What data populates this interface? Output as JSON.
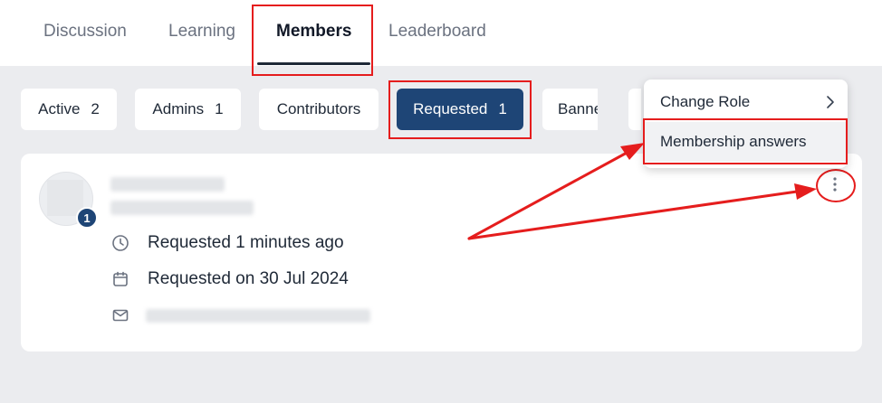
{
  "tabs": [
    {
      "label": "Discussion",
      "active": false
    },
    {
      "label": "Learning",
      "active": false
    },
    {
      "label": "Members",
      "active": true
    },
    {
      "label": "Leaderboard",
      "active": false
    }
  ],
  "filters": [
    {
      "label": "Active",
      "count": "2",
      "active": false
    },
    {
      "label": "Admins",
      "count": "1",
      "active": false
    },
    {
      "label": "Contributors",
      "count": "",
      "active": false
    },
    {
      "label": "Requested",
      "count": "1",
      "active": true
    },
    {
      "label": "Banne",
      "count": "",
      "active": false
    }
  ],
  "member": {
    "badge_count": "1",
    "requested_ago": "Requested 1 minutes ago",
    "requested_on": "Requested on 30 Jul 2024"
  },
  "menu": {
    "items": [
      {
        "label": "Change Role",
        "has_submenu": true
      },
      {
        "label": "Membership answers",
        "has_submenu": false
      }
    ]
  },
  "colors": {
    "accent": "#1e4576",
    "annotation": "#e51d1d",
    "page_bg": "#ebecef"
  },
  "icons": [
    "clock-icon",
    "calendar-icon",
    "mail-icon",
    "more-vertical-icon",
    "chevron-right-icon"
  ]
}
